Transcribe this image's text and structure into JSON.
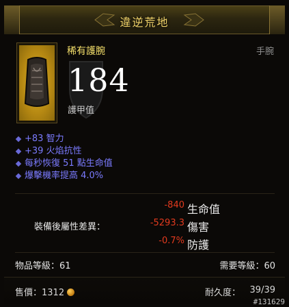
{
  "header": {
    "title": "違逆荒地"
  },
  "item": {
    "name": "稀有護腕",
    "slot": "手腕",
    "armor_value": "184",
    "armor_label": "護甲值",
    "icon": "bracer-icon"
  },
  "affixes": [
    "+83 智力",
    "+39 火焰抗性",
    "每秒恢復 51 點生命值",
    "爆擊機率提高 4.0%"
  ],
  "comparison": {
    "label": "裝備後屬性差異：",
    "rows": [
      {
        "value": "-840",
        "name": "生命值"
      },
      {
        "value": "-5293.3",
        "name": "傷害"
      },
      {
        "value": "-0.7%",
        "name": "防護"
      }
    ]
  },
  "levels": {
    "item_level": "物品等級：61",
    "required_level": "需要等級：60"
  },
  "footer": {
    "price_label": "售價：1312",
    "durability_label": "耐久度：",
    "durability_value": "39/39",
    "coin_icon": "gold-coin-icon"
  },
  "watermark": "#131629",
  "colors": {
    "header_text": "#f3d56a",
    "item_name": "#f5e06b",
    "affix": "#7b7bff",
    "negative": "#e33a1e"
  }
}
